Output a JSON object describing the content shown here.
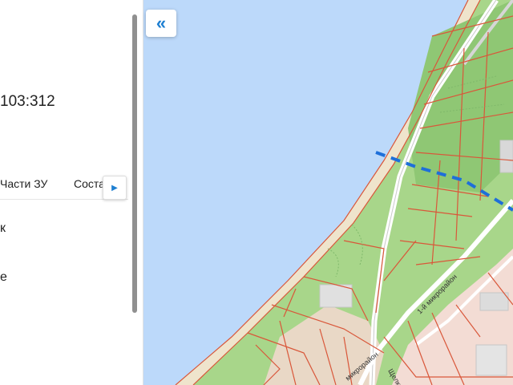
{
  "panel": {
    "cadastral_number": "103:312",
    "tabs": [
      {
        "label": "Части ЗУ"
      },
      {
        "label": "Соста"
      }
    ],
    "tab_next_icon": "triangle-right-icon",
    "fragments": [
      "к",
      "е"
    ]
  },
  "map": {
    "collapse_icon": "double-chevron-left-icon",
    "labels": {
      "microdistrict": "1-й микрорайон",
      "microdistrict_short": "микрорайон",
      "street": "Щелкина"
    },
    "colors": {
      "water": "#bcd9fa",
      "green": "#a8d68a",
      "sand": "#efe4cc",
      "parcel_line": "#d9573a",
      "boundary": "#1e6fd9"
    }
  }
}
